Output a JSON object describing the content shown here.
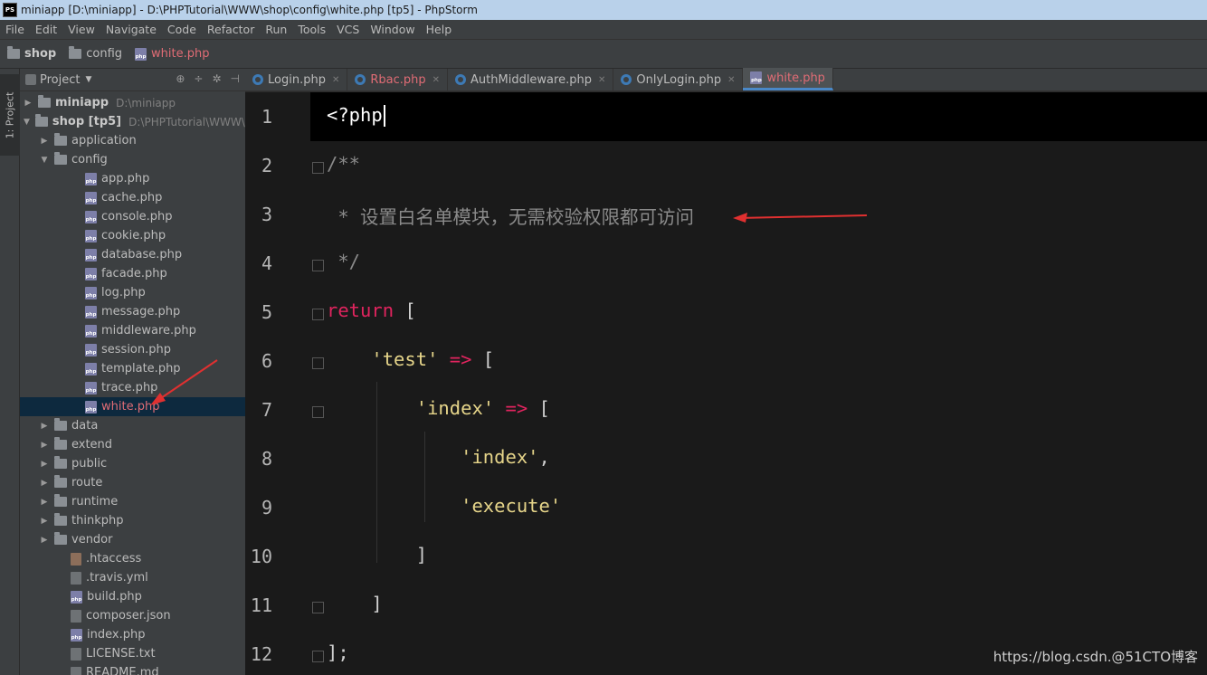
{
  "window": {
    "title": "miniapp [D:\\miniapp] - D:\\PHPTutorial\\WWW\\shop\\config\\white.php [tp5] - PhpStorm",
    "logo": "PS"
  },
  "menu": [
    "File",
    "Edit",
    "View",
    "Navigate",
    "Code",
    "Refactor",
    "Run",
    "Tools",
    "VCS",
    "Window",
    "Help"
  ],
  "breadcrumb": {
    "root": "shop",
    "folder": "config",
    "file": "white.php"
  },
  "toolstrip": {
    "project_tab": "1: Project"
  },
  "project_panel": {
    "title": "Project",
    "tree": [
      {
        "label": "miniapp",
        "path": "D:\\miniapp",
        "kind": "folder",
        "bold": true,
        "arrow": "▶"
      },
      {
        "label": "shop [tp5]",
        "path": "D:\\PHPTutorial\\WWW\\sh",
        "kind": "folder",
        "bold": true,
        "arrow": "▼"
      },
      {
        "label": "application",
        "kind": "folder",
        "arrow": "▶"
      },
      {
        "label": "config",
        "kind": "folder",
        "arrow": "▼"
      },
      {
        "label": "app.php",
        "kind": "php"
      },
      {
        "label": "cache.php",
        "kind": "php"
      },
      {
        "label": "console.php",
        "kind": "php"
      },
      {
        "label": "cookie.php",
        "kind": "php"
      },
      {
        "label": "database.php",
        "kind": "php"
      },
      {
        "label": "facade.php",
        "kind": "php"
      },
      {
        "label": "log.php",
        "kind": "php"
      },
      {
        "label": "message.php",
        "kind": "php"
      },
      {
        "label": "middleware.php",
        "kind": "php"
      },
      {
        "label": "session.php",
        "kind": "php"
      },
      {
        "label": "template.php",
        "kind": "php"
      },
      {
        "label": "trace.php",
        "kind": "php"
      },
      {
        "label": "white.php",
        "kind": "php",
        "selected": true
      },
      {
        "label": "data",
        "kind": "folder",
        "arrow": "▶"
      },
      {
        "label": "extend",
        "kind": "folder",
        "arrow": "▶"
      },
      {
        "label": "public",
        "kind": "folder",
        "arrow": "▶"
      },
      {
        "label": "route",
        "kind": "folder",
        "arrow": "▶"
      },
      {
        "label": "runtime",
        "kind": "folder",
        "arrow": "▶"
      },
      {
        "label": "thinkphp",
        "kind": "folder",
        "arrow": "▶"
      },
      {
        "label": "vendor",
        "kind": "folder",
        "arrow": "▶"
      },
      {
        "label": ".htaccess",
        "kind": "htaccess"
      },
      {
        "label": ".travis.yml",
        "kind": "generic"
      },
      {
        "label": "build.php",
        "kind": "php"
      },
      {
        "label": "composer.json",
        "kind": "generic"
      },
      {
        "label": "index.php",
        "kind": "php"
      },
      {
        "label": "LICENSE.txt",
        "kind": "generic"
      },
      {
        "label": "README.md",
        "kind": "generic"
      }
    ]
  },
  "tabs": [
    {
      "label": "Login.php",
      "icon": "class-icon"
    },
    {
      "label": "Rbac.php",
      "icon": "class-icon",
      "red": true
    },
    {
      "label": "AuthMiddleware.php",
      "icon": "class-icon"
    },
    {
      "label": "OnlyLogin.php",
      "icon": "class-icon"
    },
    {
      "label": "white.php",
      "icon": "php-file-icon",
      "red": true,
      "active": true
    }
  ],
  "editor": {
    "lines": [
      [
        {
          "t": "<?php",
          "c": "c-white"
        }
      ],
      [
        {
          "t": "/**",
          "c": "c-gray"
        }
      ],
      [
        {
          "t": " * 设置白名单模块，无需校验权限都可访问",
          "c": "c-gray"
        }
      ],
      [
        {
          "t": " */",
          "c": "c-gray"
        }
      ],
      [
        {
          "t": "return",
          "c": "c-red"
        },
        {
          "t": " [",
          "c": "c-plain"
        }
      ],
      [
        {
          "t": "    ",
          "c": "c-plain"
        },
        {
          "t": "'test'",
          "c": "c-str"
        },
        {
          "t": " ",
          "c": "c-plain"
        },
        {
          "t": "=>",
          "c": "c-red"
        },
        {
          "t": " [",
          "c": "c-plain"
        }
      ],
      [
        {
          "t": "        ",
          "c": "c-plain"
        },
        {
          "t": "'index'",
          "c": "c-str"
        },
        {
          "t": " ",
          "c": "c-plain"
        },
        {
          "t": "=>",
          "c": "c-red"
        },
        {
          "t": " [",
          "c": "c-plain"
        }
      ],
      [
        {
          "t": "            ",
          "c": "c-plain"
        },
        {
          "t": "'index'",
          "c": "c-str"
        },
        {
          "t": ",",
          "c": "c-plain"
        }
      ],
      [
        {
          "t": "            ",
          "c": "c-plain"
        },
        {
          "t": "'execute'",
          "c": "c-str"
        }
      ],
      [
        {
          "t": "        ]",
          "c": "c-plain"
        }
      ],
      [
        {
          "t": "    ]",
          "c": "c-plain"
        }
      ],
      [
        {
          "t": "];",
          "c": "c-plain"
        }
      ]
    ]
  },
  "watermark": "https://blog.csdn.@51CTO博客",
  "colors": {
    "accent_red": "#e06c75",
    "keyword": "#e0245e",
    "string": "#e6d58a",
    "selection": "#0d293e"
  }
}
